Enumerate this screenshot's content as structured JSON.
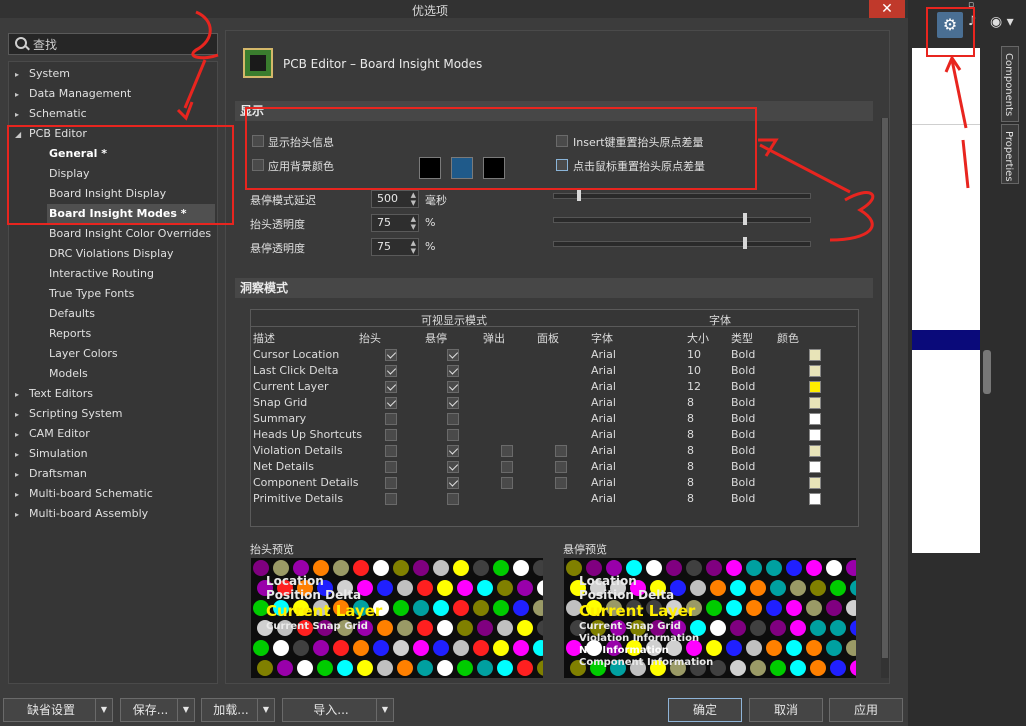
{
  "window": {
    "title": "优选项",
    "close": "✕"
  },
  "search": {
    "placeholder": "查找"
  },
  "tree": [
    {
      "label": "System",
      "arrow": "▸"
    },
    {
      "label": "Data Management",
      "arrow": "▸"
    },
    {
      "label": "Schematic",
      "arrow": "▸"
    },
    {
      "label": "PCB Editor",
      "arrow": "◢"
    },
    {
      "label": "General *"
    },
    {
      "label": "Display"
    },
    {
      "label": "Board Insight Display"
    },
    {
      "label": "Board Insight Modes *"
    },
    {
      "label": "Board Insight Color Overrides"
    },
    {
      "label": "DRC Violations Display"
    },
    {
      "label": "Interactive Routing"
    },
    {
      "label": "True Type Fonts"
    },
    {
      "label": "Defaults"
    },
    {
      "label": "Reports"
    },
    {
      "label": "Layer Colors"
    },
    {
      "label": "Models"
    },
    {
      "label": "Text Editors",
      "arrow": "▸"
    },
    {
      "label": "Scripting System",
      "arrow": "▸"
    },
    {
      "label": "CAM Editor",
      "arrow": "▸"
    },
    {
      "label": "Simulation",
      "arrow": "▸"
    },
    {
      "label": "Draftsman",
      "arrow": "▸"
    },
    {
      "label": "Multi-board Schematic",
      "arrow": "▸"
    },
    {
      "label": "Multi-board Assembly",
      "arrow": "▸"
    }
  ],
  "page": {
    "title": "PCB Editor – Board Insight Modes"
  },
  "display": {
    "section": "显示",
    "show_heads_up": "显示抬头信息",
    "use_bg_color": "应用背景颜色",
    "insert_reset": "Insert键重置抬头原点差量",
    "click_reset": "点击鼠标重置抬头原点差量",
    "hover_delay_label": "悬停模式延迟",
    "hover_delay_value": "500",
    "hover_delay_unit": "毫秒",
    "hud_opacity_label": "抬头透明度",
    "hud_opacity_value": "75",
    "hud_opacity_unit": "%",
    "hover_opacity_label": "悬停透明度",
    "hover_opacity_value": "75",
    "hover_opacity_unit": "%",
    "hover_delay_slider": 0.09,
    "hud_opacity_slider": 0.75,
    "hover_opacity_slider": 0.75,
    "colors": [
      "#000000",
      "#1f5a8a",
      "#000000"
    ]
  },
  "insight": {
    "section": "洞察模式",
    "group_visible": "可视显示模式",
    "group_font": "字体",
    "headers": {
      "desc": "描述",
      "heads": "抬头",
      "hover": "悬停",
      "popup": "弹出",
      "panel": "面板",
      "font": "字体",
      "size": "大小",
      "type": "类型",
      "color": "颜色"
    },
    "rows": [
      {
        "desc": "Cursor Location",
        "heads": true,
        "hover": true,
        "popup": null,
        "panel": null,
        "font": "Arial",
        "size": "10",
        "type": "Bold",
        "color": "#e8e4b8"
      },
      {
        "desc": "Last Click Delta",
        "heads": true,
        "hover": true,
        "popup": null,
        "panel": null,
        "font": "Arial",
        "size": "10",
        "type": "Bold",
        "color": "#e8e4b8"
      },
      {
        "desc": "Current Layer",
        "heads": true,
        "hover": true,
        "popup": null,
        "panel": null,
        "font": "Arial",
        "size": "12",
        "type": "Bold",
        "color": "#ffee00"
      },
      {
        "desc": "Snap Grid",
        "heads": true,
        "hover": true,
        "popup": null,
        "panel": null,
        "font": "Arial",
        "size": "8",
        "type": "Bold",
        "color": "#e8e4b8"
      },
      {
        "desc": "Summary",
        "heads": false,
        "hover": false,
        "popup": null,
        "panel": null,
        "font": "Arial",
        "size": "8",
        "type": "Bold",
        "color": "#ffffff"
      },
      {
        "desc": "Heads Up Shortcuts",
        "heads": false,
        "hover": false,
        "popup": null,
        "panel": null,
        "font": "Arial",
        "size": "8",
        "type": "Bold",
        "color": "#ffffff"
      },
      {
        "desc": "Violation Details",
        "heads": false,
        "hover": true,
        "popup": false,
        "panel": false,
        "font": "Arial",
        "size": "8",
        "type": "Bold",
        "color": "#e8e4b8"
      },
      {
        "desc": "Net Details",
        "heads": false,
        "hover": true,
        "popup": false,
        "panel": false,
        "font": "Arial",
        "size": "8",
        "type": "Bold",
        "color": "#ffffff"
      },
      {
        "desc": "Component Details",
        "heads": false,
        "hover": true,
        "popup": false,
        "panel": false,
        "font": "Arial",
        "size": "8",
        "type": "Bold",
        "color": "#e8e4b8"
      },
      {
        "desc": "Primitive Details",
        "heads": false,
        "hover": false,
        "popup": null,
        "panel": null,
        "font": "Arial",
        "size": "8",
        "type": "Bold",
        "color": "#ffffff"
      }
    ]
  },
  "preview": {
    "hud_label": "抬头预览",
    "hover_label": "悬停预览",
    "hud_lines": [
      "Location",
      "Position Delta",
      "Current Layer",
      "Current Snap Grid"
    ],
    "hover_lines": [
      "Location",
      "Position Delta",
      "Current Layer",
      "Current Snap Grid",
      "Violation Information",
      "Net Information",
      "Component Information"
    ]
  },
  "buttons": {
    "defaults": "缺省设置",
    "save": "保存...",
    "load": "加载...",
    "import": "导入...",
    "ok": "确定",
    "cancel": "取消",
    "apply": "应用"
  },
  "side": {
    "components": "Components",
    "properties": "Properties",
    "restore": "▫"
  }
}
